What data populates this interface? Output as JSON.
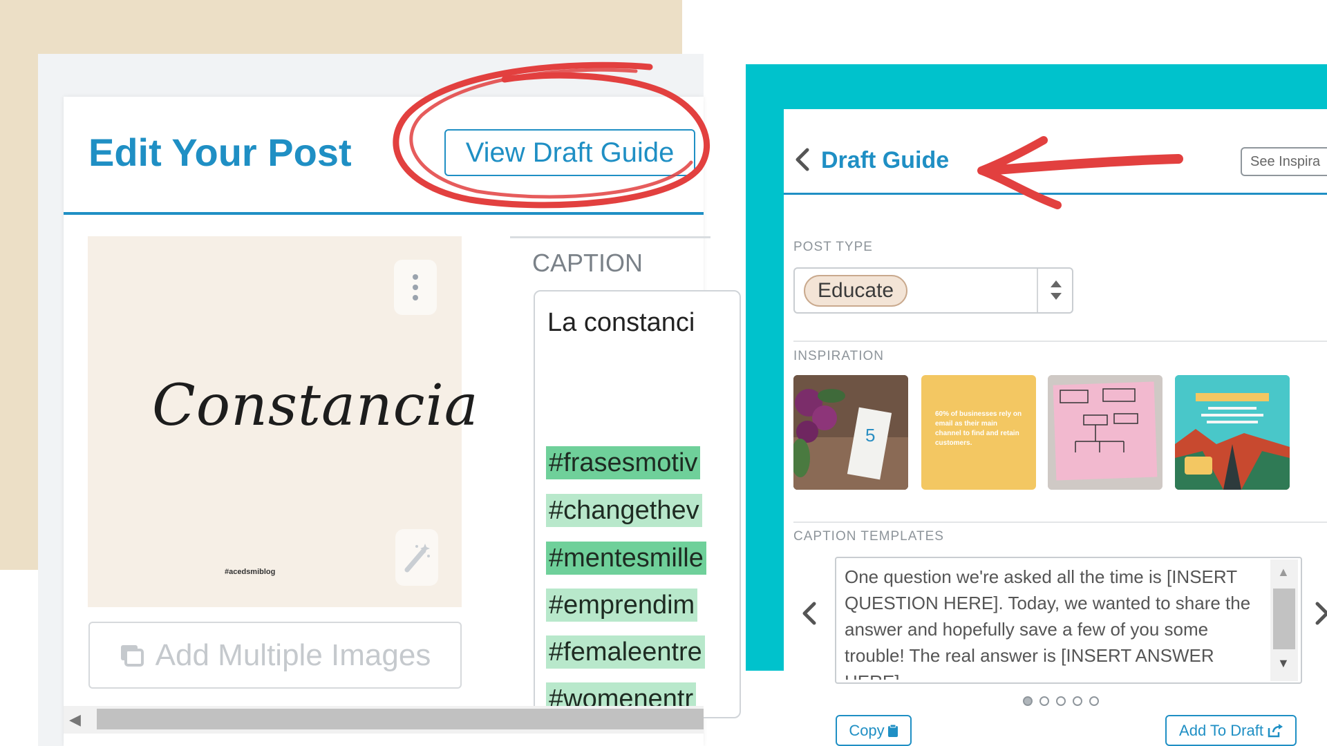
{
  "left_panel": {
    "title": "Edit Your Post",
    "view_draft_guide_label": "View Draft Guide",
    "image": {
      "script_text": "Constancia",
      "handle": "#acedsmiblog"
    },
    "add_multiple_images_label": "Add Multiple Images",
    "caption": {
      "label": "CAPTION",
      "text": "La constanci",
      "hashtags": [
        "#frasesmotiv",
        "#changethev",
        "#mentesmille",
        "#emprendim",
        "#femaleentre",
        "#womenentr"
      ]
    }
  },
  "right_panel": {
    "title": "Draft Guide",
    "see_inspiration_label": "See Inspira",
    "post_type_label": "POST TYPE",
    "post_type_value": "Educate",
    "inspiration_label": "INSPIRATION",
    "inspiration_thumbs": [
      {
        "caption": ""
      },
      {
        "caption": "60% of businesses rely on email as their main channel to find and retain customers."
      },
      {
        "caption": ""
      },
      {
        "caption": ""
      }
    ],
    "caption_templates_label": "CAPTION TEMPLATES",
    "caption_template_text": "One question we're asked all the time is [INSERT QUESTION HERE]. Today, we wanted to share the answer and hopefully save a few of you some trouble! The real answer is [INSERT ANSWER HERE]",
    "pagination": {
      "total": 5,
      "active": 0
    },
    "copy_label": "Copy",
    "add_to_draft_label": "Add To Draft"
  },
  "colors": {
    "brand_blue": "#1f8fc4",
    "teal": "#00c2cc",
    "beige": "#ecdfc6",
    "annotation_red": "#e2403f",
    "hashtag_green_dark": "#6fd09a",
    "hashtag_green_light": "#b8e8cb"
  },
  "icons": [
    "kebab-menu-icon",
    "magic-wand-icon",
    "images-icon",
    "chevron-left-icon",
    "chevron-right-icon",
    "select-arrows-icon",
    "clipboard-icon",
    "share-out-icon"
  ]
}
